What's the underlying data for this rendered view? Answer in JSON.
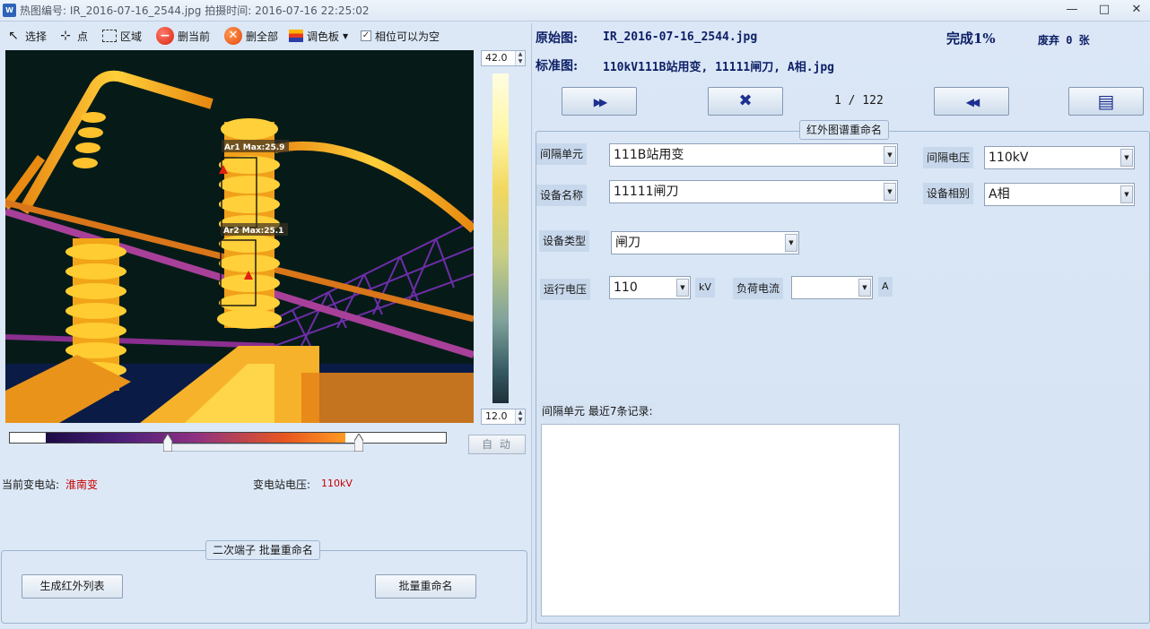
{
  "window": {
    "title": "热图编号: IR_2016-07-16_2544.jpg  拍摄时间: 2016-07-16 22:25:02",
    "min": "—",
    "max": "□",
    "close": "✕"
  },
  "toolbar": {
    "select": "选择",
    "point": "点",
    "area": "区域",
    "delete_current": "删当前",
    "delete_all": "删全部",
    "palette": "调色板",
    "phase_empty": "相位可以为空",
    "phase_empty_checked": "✓"
  },
  "thermal": {
    "labels": [
      "Ar1 Max:25.9",
      "Ar2 Max:25.1"
    ],
    "max_temp": "42.0",
    "min_temp": "12.0",
    "auto_label": "自 动"
  },
  "station": {
    "current_label": "当前变电站:",
    "current_value": "淮南变",
    "voltage_label": "变电站电压:",
    "voltage_value": "110kV"
  },
  "batch": {
    "legend": "二次端子 批量重命名",
    "generate_btn": "生成红外列表",
    "rename_btn": "批量重命名"
  },
  "header": {
    "original_label": "原始图:",
    "original_value": "IR_2016-07-16_2544.jpg",
    "standard_label": "标准图:",
    "standard_value": "110kV111B站用变, 11111闸刀, A相.jpg",
    "complete": "完成1%",
    "discard": "废弃 0 张"
  },
  "nav": {
    "next": "▶▶",
    "delete": "✖",
    "counter": "1 / 122",
    "prev": "◀◀",
    "doc": "▤"
  },
  "rename": {
    "legend": "红外图谱重命名",
    "bay_label": "间隔单元",
    "bay_value": "111B站用变",
    "bay_voltage_label": "间隔电压",
    "bay_voltage_value": "110kV",
    "device_label": "设备名称",
    "device_value": "11111闸刀",
    "phase_label": "设备相别",
    "phase_value": "A相",
    "type_label": "设备类型",
    "type_value": "闸刀",
    "run_voltage_label": "运行电压",
    "run_voltage_value": "110",
    "run_voltage_unit": "kV",
    "load_current_label": "负荷电流",
    "load_current_value": "",
    "load_current_unit": "A",
    "records_label": "间隔单元 最近7条记录:"
  }
}
